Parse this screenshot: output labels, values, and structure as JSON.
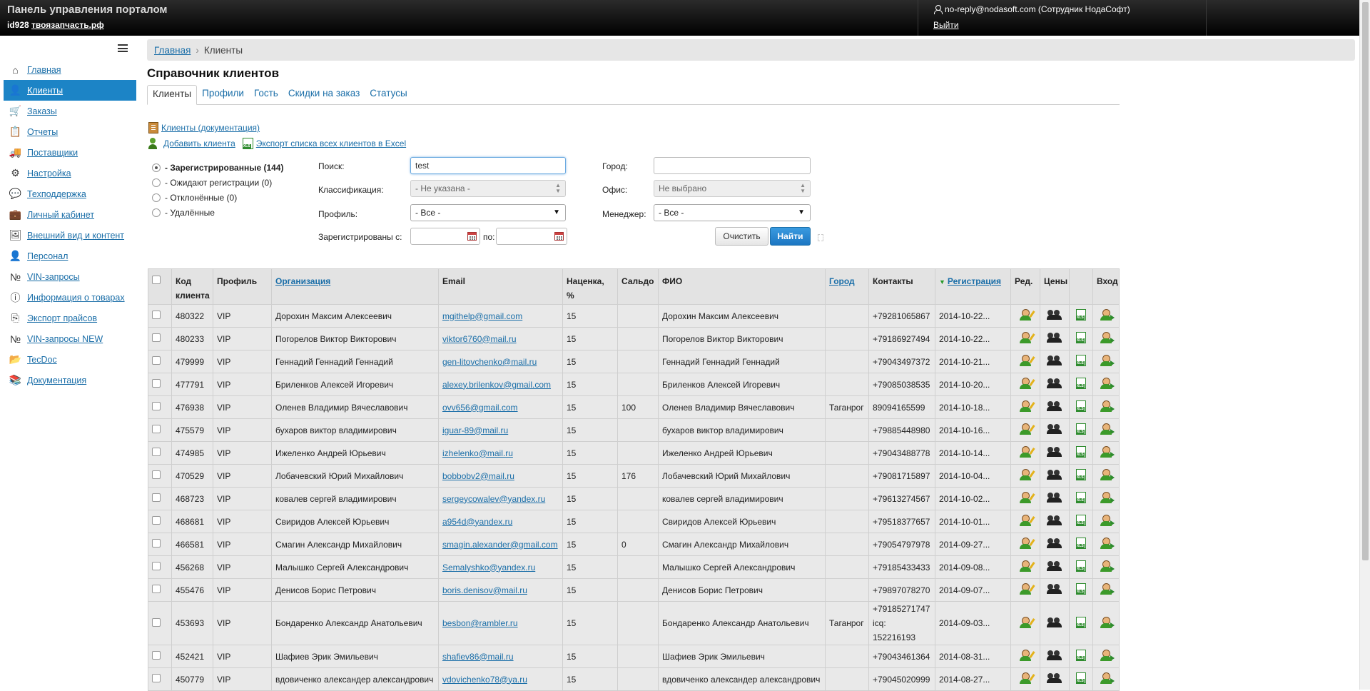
{
  "header": {
    "title": "Панель управления порталом",
    "site_id": "id928",
    "site_name": "твоязапчасть.рф",
    "user": "no-reply@nodasoft.com (Сотрудник НодаСофт)",
    "logout": "Выйти"
  },
  "sidebar": {
    "items": [
      {
        "label": "Главная",
        "icon": "home-icon"
      },
      {
        "label": "Клиенты",
        "icon": "clients-icon"
      },
      {
        "label": "Заказы",
        "icon": "cart-icon"
      },
      {
        "label": "Отчеты",
        "icon": "clipboard-icon"
      },
      {
        "label": "Поставщики",
        "icon": "truck-icon"
      },
      {
        "label": "Настройка",
        "icon": "gear-icon"
      },
      {
        "label": "Техподдержка",
        "icon": "chat-icon"
      },
      {
        "label": "Личный кабинет",
        "icon": "briefcase-icon"
      },
      {
        "label": "Внешний вид и контент",
        "icon": "picture-icon"
      },
      {
        "label": "Персонал",
        "icon": "staff-icon"
      },
      {
        "label": "VIN-запросы",
        "icon": "number-icon"
      },
      {
        "label": "Информация о товарах",
        "icon": "info-icon"
      },
      {
        "label": "Экспорт прайсов",
        "icon": "export-icon"
      },
      {
        "label": "VIN-запросы NEW",
        "icon": "number-icon"
      },
      {
        "label": "TecDoc",
        "icon": "folder-icon"
      },
      {
        "label": "Документация",
        "icon": "books-icon"
      }
    ]
  },
  "breadcrumb": {
    "home": "Главная",
    "current": "Клиенты"
  },
  "page_title": "Справочник клиентов",
  "tabs": [
    "Клиенты",
    "Профили",
    "Гость",
    "Скидки на заказ",
    "Статусы"
  ],
  "links": {
    "docs": "Клиенты (документация)",
    "add": "Добавить клиента",
    "export": "Экспорт списка всех клиентов в Excel"
  },
  "filters": {
    "status_options": [
      "- Зарегистрированные (144)",
      "- Ожидают регистрации (0)",
      "- Отклонённые (0)",
      "- Удалённые"
    ],
    "search_label": "Поиск:",
    "search_value": "test",
    "class_label": "Классификация:",
    "class_value": "- Не указана -",
    "profile_label": "Профиль:",
    "profile_value": "- Все -",
    "registered_label": "Зарегистрированы с:",
    "to_label": "по:",
    "city_label": "Город:",
    "city_value": "",
    "office_label": "Офис:",
    "office_value": "Не выбрано",
    "manager_label": "Менеджер:",
    "manager_value": "- Все -",
    "clear_button": "Очистить",
    "find_button": "Найти"
  },
  "table": {
    "headers": {
      "code": "Код клиента",
      "profile": "Профиль",
      "org": "Организация",
      "email": "Email",
      "markup": "Наценка, %",
      "balance": "Сальдо",
      "name": "ФИО",
      "city": "Город",
      "contacts": "Контакты",
      "reg": "Регистрация",
      "edit": "Ред.",
      "prices": "Цены",
      "login": "Вход"
    },
    "rows": [
      {
        "code": "480322",
        "profile": "VIP",
        "org": "Дорохин Максим Алексеевич",
        "email": "mgithelp@gmail.com",
        "markup": "15",
        "balance": "",
        "name": "Дорохин Максим Алексеевич",
        "city": "",
        "contacts": "+79281065867",
        "contacts2": "",
        "reg": "2014-10-22..."
      },
      {
        "code": "480233",
        "profile": "VIP",
        "org": "Погорелов Виктор Викторович",
        "email": "viktor6760@mail.ru",
        "markup": "15",
        "balance": "",
        "name": "Погорелов Виктор Викторович",
        "city": "",
        "contacts": "+79186927494",
        "contacts2": "",
        "reg": "2014-10-22..."
      },
      {
        "code": "479999",
        "profile": "VIP",
        "org": "Геннадий Геннадий Геннадий",
        "email": "gen-litovchenko@mail.ru",
        "markup": "15",
        "balance": "",
        "name": "Геннадий Геннадий Геннадий",
        "city": "",
        "contacts": "+79043497372",
        "contacts2": "",
        "reg": "2014-10-21..."
      },
      {
        "code": "477791",
        "profile": "VIP",
        "org": "Бриленков Алексей Игоревич",
        "email": "alexey.brilenkov@gmail.com",
        "markup": "15",
        "balance": "",
        "name": "Бриленков Алексей Игоревич",
        "city": "",
        "contacts": "+79085038535",
        "contacts2": "",
        "reg": "2014-10-20..."
      },
      {
        "code": "476938",
        "profile": "VIP",
        "org": "Оленев Владимир Вячеславович",
        "email": "ovv656@gmail.com",
        "markup": "15",
        "balance": "100",
        "name": "Оленев Владимир Вячеславович",
        "city": "Таганрог",
        "contacts": "89094165599",
        "contacts2": "",
        "reg": "2014-10-18..."
      },
      {
        "code": "475579",
        "profile": "VIP",
        "org": "бухаров виктор владимирович",
        "email": "iguar-89@mail.ru",
        "markup": "15",
        "balance": "",
        "name": "бухаров виктор владимирович",
        "city": "",
        "contacts": "+79885448980",
        "contacts2": "",
        "reg": "2014-10-16..."
      },
      {
        "code": "474985",
        "profile": "VIP",
        "org": "Ижеленко Андрей Юрьевич",
        "email": "izhelenko@mail.ru",
        "markup": "15",
        "balance": "",
        "name": "Ижеленко Андрей Юрьевич",
        "city": "",
        "contacts": "+79043488778",
        "contacts2": "",
        "reg": "2014-10-14..."
      },
      {
        "code": "470529",
        "profile": "VIP",
        "org": "Лобачевский Юрий Михайлович",
        "email": "bobbobv2@mail.ru",
        "markup": "15",
        "balance": "176",
        "name": "Лобачевский Юрий Михайлович",
        "city": "",
        "contacts": "+79081715897",
        "contacts2": "",
        "reg": "2014-10-04..."
      },
      {
        "code": "468723",
        "profile": "VIP",
        "org": "ковалев сергей владимирович",
        "email": "sergeycowalev@yandex.ru",
        "markup": "15",
        "balance": "",
        "name": "ковалев сергей владимирович",
        "city": "",
        "contacts": "+79613274567",
        "contacts2": "",
        "reg": "2014-10-02..."
      },
      {
        "code": "468681",
        "profile": "VIP",
        "org": "Свиридов Алексей Юрьевич",
        "email": "a954d@yandex.ru",
        "markup": "15",
        "balance": "",
        "name": "Свиридов Алексей Юрьевич",
        "city": "",
        "contacts": "+79518377657",
        "contacts2": "",
        "reg": "2014-10-01..."
      },
      {
        "code": "466581",
        "profile": "VIP",
        "org": "Смагин Александр Михайлович",
        "email": "smagin.alexander@gmail.com",
        "markup": "15",
        "balance": "0",
        "name": "Смагин Александр Михайлович",
        "city": "",
        "contacts": "+79054797978",
        "contacts2": "",
        "reg": "2014-09-27..."
      },
      {
        "code": "456268",
        "profile": "VIP",
        "org": "Малышко Сергей Александрович",
        "email": "Semalyshko@yandex.ru",
        "markup": "15",
        "balance": "",
        "name": "Малышко Сергей Александрович",
        "city": "",
        "contacts": "+79185433433",
        "contacts2": "",
        "reg": "2014-09-08..."
      },
      {
        "code": "455476",
        "profile": "VIP",
        "org": "Денисов Борис Петрович",
        "email": "boris.denisov@mail.ru",
        "markup": "15",
        "balance": "",
        "name": "Денисов Борис Петрович",
        "city": "",
        "contacts": "+79897078270",
        "contacts2": "",
        "reg": "2014-09-07..."
      },
      {
        "code": "453693",
        "profile": "VIP",
        "org": "Бондаренко Александр Анатольевич",
        "email": "besbon@rambler.ru",
        "markup": "15",
        "balance": "",
        "name": "Бондаренко Александр Анатольевич",
        "city": "Таганрог",
        "contacts": "+79185271747",
        "contacts2": "icq: 152216193",
        "reg": "2014-09-03..."
      },
      {
        "code": "452421",
        "profile": "VIP",
        "org": "Шафиев Эрик Эмильевич",
        "email": "shafiev86@mail.ru",
        "markup": "15",
        "balance": "",
        "name": "Шафиев Эрик Эмильевич",
        "city": "",
        "contacts": "+79043461364",
        "contacts2": "",
        "reg": "2014-08-31..."
      },
      {
        "code": "450779",
        "profile": "VIP",
        "org": "вдовиченко александер александрович",
        "email": "vdovichenko78@ya.ru",
        "markup": "15",
        "balance": "",
        "name": "вдовиченко александер александрович",
        "city": "",
        "contacts": "+79045020999",
        "contacts2": "",
        "reg": "2014-08-27..."
      }
    ]
  }
}
